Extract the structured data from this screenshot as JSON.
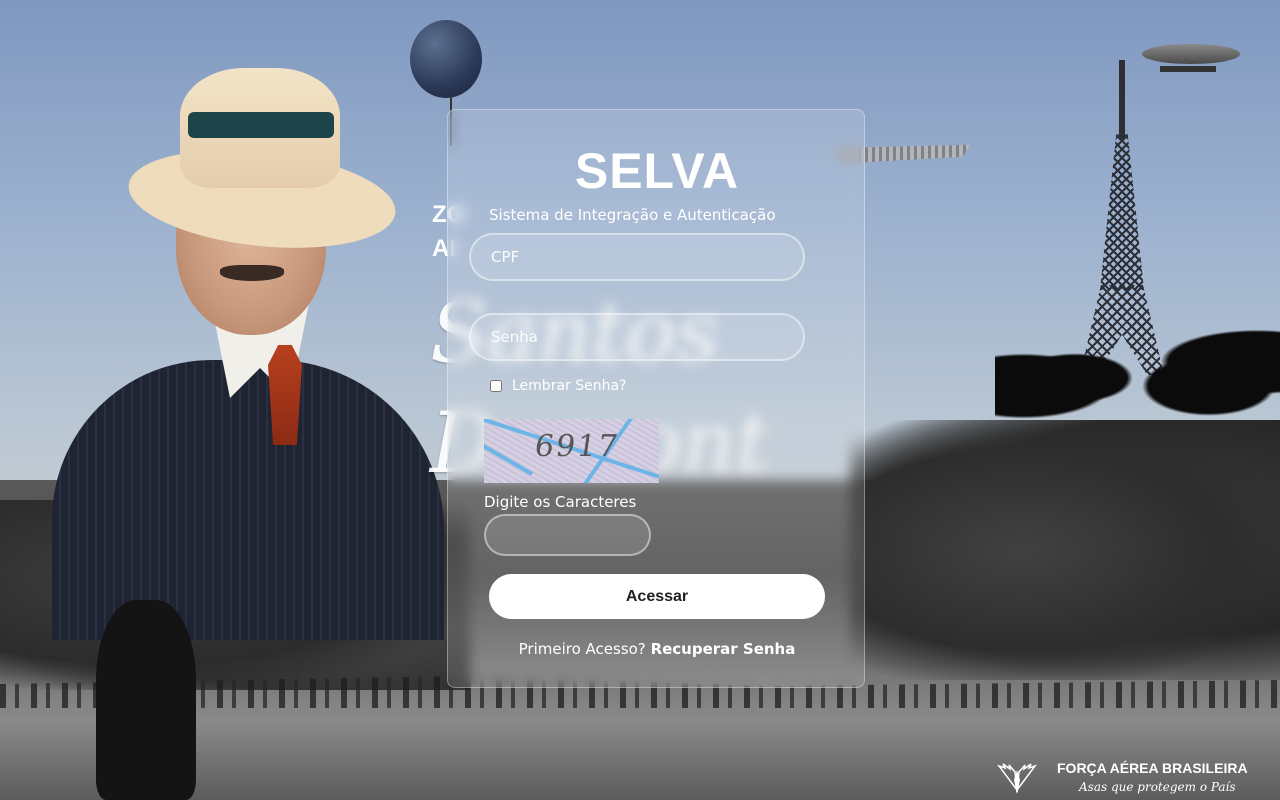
{
  "login": {
    "title": "SELVA",
    "subtitle": "Sistema de Integração e Autenticação",
    "cpf_placeholder": "CPF",
    "password_placeholder": "Senha",
    "remember_label": "Lembrar Senha?",
    "remember_checked": false,
    "captcha_value": "6917",
    "captcha_label": "Digite os Caracteres",
    "captcha_input_value": "",
    "submit_label": "Acessar",
    "first_access_label": "Primeiro Acesso?",
    "recover_label": "Recuperar Senha"
  },
  "brand": {
    "name": "FORÇA AÉREA BRASILEIRA",
    "slogan": "Asas que protegem o País",
    "emblem_icon": "wings-emblem-icon"
  },
  "background": {
    "script_text": "Santos Dumont",
    "side_badge_text": "ZO AI"
  }
}
